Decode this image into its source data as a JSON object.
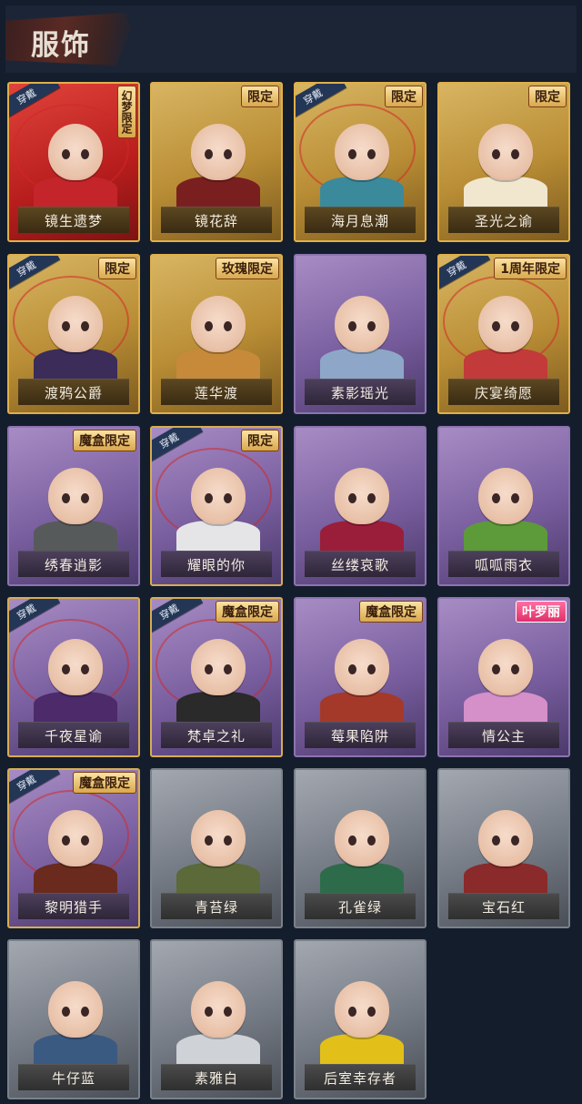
{
  "header": {
    "title": "服饰"
  },
  "common": {
    "wear_label": "穿戴"
  },
  "cards": [
    {
      "name": "镜生遗梦",
      "tier": "red",
      "equipped": true,
      "badge": "幻梦限定",
      "badge_style": "vertical",
      "hair": "#3a1a1a",
      "outfit": "#c4252a"
    },
    {
      "name": "镜花辞",
      "tier": "gold",
      "equipped": false,
      "badge": "限定",
      "badge_style": "normal",
      "hair": "#b5262d",
      "outfit": "#7a1f1f"
    },
    {
      "name": "海月息潮",
      "tier": "gold",
      "equipped": true,
      "badge": "限定",
      "badge_style": "normal",
      "hair": "#31b8b4",
      "outfit": "#3a8a9c"
    },
    {
      "name": "圣光之谕",
      "tier": "gold",
      "equipped": false,
      "badge": "限定",
      "badge_style": "normal",
      "hair": "#e9cf7a",
      "outfit": "#f1e7cf"
    },
    {
      "name": "渡鸦公爵",
      "tier": "gold",
      "equipped": true,
      "badge": "限定",
      "badge_style": "normal",
      "hair": "#1f2340",
      "outfit": "#3b2c5a"
    },
    {
      "name": "莲华渡",
      "tier": "gold",
      "equipped": false,
      "badge": "玫瑰限定",
      "badge_style": "normal",
      "hair": "#e8e2d3",
      "outfit": "#c78a3a"
    },
    {
      "name": "素影瑶光",
      "tier": "purple",
      "equipped": false,
      "badge": "",
      "badge_style": "normal",
      "hair": "#dfe8f2",
      "outfit": "#8ea7c8"
    },
    {
      "name": "庆宴绮愿",
      "tier": "gold",
      "equipped": true,
      "badge": "1周年限定",
      "badge_style": "normal",
      "hair": "#4a2a1e",
      "outfit": "#c23a3a"
    },
    {
      "name": "绣春逍影",
      "tier": "purple",
      "equipped": false,
      "badge": "魔盒限定",
      "badge_style": "normal",
      "hair": "#2d2a22",
      "outfit": "#575a5a"
    },
    {
      "name": "耀眼的你",
      "tier": "purple",
      "equipped": true,
      "badge": "限定",
      "badge_style": "normal",
      "hair": "#5a3424",
      "outfit": "#e5e5e8"
    },
    {
      "name": "丝缕哀歌",
      "tier": "purple",
      "equipped": false,
      "badge": "",
      "badge_style": "normal",
      "hair": "#b3aab3",
      "outfit": "#9a1e3a"
    },
    {
      "name": "呱呱雨衣",
      "tier": "purple",
      "equipped": false,
      "badge": "",
      "badge_style": "normal",
      "hair": "#6a3e26",
      "outfit": "#5d9a3a"
    },
    {
      "name": "千夜星谕",
      "tier": "purple",
      "equipped": true,
      "badge": "",
      "badge_style": "normal",
      "hair": "#a8333a",
      "outfit": "#4d2a6a"
    },
    {
      "name": "梵卓之礼",
      "tier": "purple",
      "equipped": true,
      "badge": "魔盒限定",
      "badge_style": "normal",
      "hair": "#e6e6e6",
      "outfit": "#2a2a2a"
    },
    {
      "name": "莓果陷阱",
      "tier": "purple",
      "equipped": false,
      "badge": "魔盒限定",
      "badge_style": "normal",
      "hair": "#e0a94a",
      "outfit": "#a4392a"
    },
    {
      "name": "情公主",
      "tier": "purple",
      "equipped": false,
      "badge": "叶罗丽",
      "badge_style": "pink",
      "hair": "#ea7fc0",
      "outfit": "#d58fc9"
    },
    {
      "name": "黎明猎手",
      "tier": "purple",
      "equipped": true,
      "badge": "魔盒限定",
      "badge_style": "normal",
      "hair": "#b9bec7",
      "outfit": "#6a2a1e"
    },
    {
      "name": "青苔绿",
      "tier": "gray",
      "equipped": false,
      "badge": "",
      "badge_style": "normal",
      "hair": "#5a3324",
      "outfit": "#5b6a38"
    },
    {
      "name": "孔雀绿",
      "tier": "gray",
      "equipped": false,
      "badge": "",
      "badge_style": "normal",
      "hair": "#5a3324",
      "outfit": "#2e6b4a"
    },
    {
      "name": "宝石红",
      "tier": "gray",
      "equipped": false,
      "badge": "",
      "badge_style": "normal",
      "hair": "#5a3324",
      "outfit": "#8a2a2a"
    },
    {
      "name": "牛仔蓝",
      "tier": "gray",
      "equipped": false,
      "badge": "",
      "badge_style": "normal",
      "hair": "#5a3324",
      "outfit": "#3a5a82"
    },
    {
      "name": "素雅白",
      "tier": "gray",
      "equipped": false,
      "badge": "",
      "badge_style": "normal",
      "hair": "#5a3324",
      "outfit": "#cfd2d6"
    },
    {
      "name": "后室幸存者",
      "tier": "gray",
      "equipped": false,
      "badge": "",
      "badge_style": "normal",
      "hair": "#e8c51a",
      "outfit": "#e2c019"
    }
  ]
}
